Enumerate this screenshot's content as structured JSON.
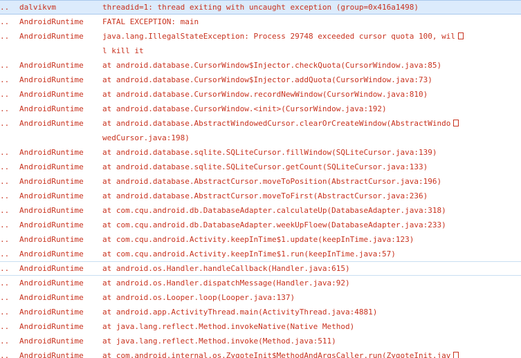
{
  "log": {
    "rows": [
      {
        "level": "..",
        "tag": "dalvikvm",
        "text": "threadid=1: thread exiting with uncaught exception (group=0x416a1498)",
        "wrap": false,
        "selected": true
      },
      {
        "level": "..",
        "tag": "AndroidRuntime",
        "text": "FATAL EXCEPTION: main",
        "wrap": false
      },
      {
        "level": "..",
        "tag": "AndroidRuntime",
        "text": "java.lang.IllegalStateException: Process 29748 exceeded cursor quota 100, wil",
        "wrap": true
      },
      {
        "level": "",
        "tag": "",
        "text": "l kill it",
        "wrap": false
      },
      {
        "level": "..",
        "tag": "AndroidRuntime",
        "text": "at android.database.CursorWindow$Injector.checkQuota(CursorWindow.java:85)",
        "wrap": false
      },
      {
        "level": "..",
        "tag": "AndroidRuntime",
        "text": "at android.database.CursorWindow$Injector.addQuota(CursorWindow.java:73)",
        "wrap": false
      },
      {
        "level": "..",
        "tag": "AndroidRuntime",
        "text": "at android.database.CursorWindow.recordNewWindow(CursorWindow.java:810)",
        "wrap": false
      },
      {
        "level": "..",
        "tag": "AndroidRuntime",
        "text": "at android.database.CursorWindow.<init>(CursorWindow.java:192)",
        "wrap": false
      },
      {
        "level": "..",
        "tag": "AndroidRuntime",
        "text": "at android.database.AbstractWindowedCursor.clearOrCreateWindow(AbstractWindo",
        "wrap": true
      },
      {
        "level": "",
        "tag": "",
        "text": "wedCursor.java:198)",
        "wrap": false
      },
      {
        "level": "..",
        "tag": "AndroidRuntime",
        "text": "at android.database.sqlite.SQLiteCursor.fillWindow(SQLiteCursor.java:139)",
        "wrap": false
      },
      {
        "level": "..",
        "tag": "AndroidRuntime",
        "text": "at android.database.sqlite.SQLiteCursor.getCount(SQLiteCursor.java:133)",
        "wrap": false
      },
      {
        "level": "..",
        "tag": "AndroidRuntime",
        "text": "at android.database.AbstractCursor.moveToPosition(AbstractCursor.java:196)",
        "wrap": false
      },
      {
        "level": "..",
        "tag": "AndroidRuntime",
        "text": "at android.database.AbstractCursor.moveToFirst(AbstractCursor.java:236)",
        "wrap": false
      },
      {
        "level": "..",
        "tag": "AndroidRuntime",
        "text": "at com.cqu.android.db.DatabaseAdapter.calculateUp(DatabaseAdapter.java:318)",
        "wrap": false
      },
      {
        "level": "..",
        "tag": "AndroidRuntime",
        "text": "at com.cqu.android.db.DatabaseAdapter.weekUpFloew(DatabaseAdapter.java:233)",
        "wrap": false
      },
      {
        "level": "..",
        "tag": "AndroidRuntime",
        "text": "at com.cqu.android.Activity.keepInTime$1.update(keepInTime.java:123)",
        "wrap": false
      },
      {
        "level": "..",
        "tag": "AndroidRuntime",
        "text": "at com.cqu.android.Activity.keepInTime$1.run(keepInTime.java:57)",
        "wrap": false
      },
      {
        "level": "..",
        "tag": "AndroidRuntime",
        "text": "at android.os.Handler.handleCallback(Handler.java:615)",
        "wrap": false,
        "hover": true
      },
      {
        "level": "..",
        "tag": "AndroidRuntime",
        "text": "at android.os.Handler.dispatchMessage(Handler.java:92)",
        "wrap": false
      },
      {
        "level": "..",
        "tag": "AndroidRuntime",
        "text": "at android.os.Looper.loop(Looper.java:137)",
        "wrap": false
      },
      {
        "level": "..",
        "tag": "AndroidRuntime",
        "text": "at android.app.ActivityThread.main(ActivityThread.java:4881)",
        "wrap": false
      },
      {
        "level": "..",
        "tag": "AndroidRuntime",
        "text": "at java.lang.reflect.Method.invokeNative(Native Method)",
        "wrap": false
      },
      {
        "level": "..",
        "tag": "AndroidRuntime",
        "text": "at java.lang.reflect.Method.invoke(Method.java:511)",
        "wrap": false
      },
      {
        "level": "..",
        "tag": "AndroidRuntime",
        "text": "at com.android.internal.os.ZygoteInit$MethodAndArgsCaller.run(ZygoteInit.jav",
        "wrap": true
      }
    ]
  },
  "colors": {
    "error_text": "#c8321e",
    "selection_bg": "#dcebfc",
    "background": "#ffffff"
  }
}
